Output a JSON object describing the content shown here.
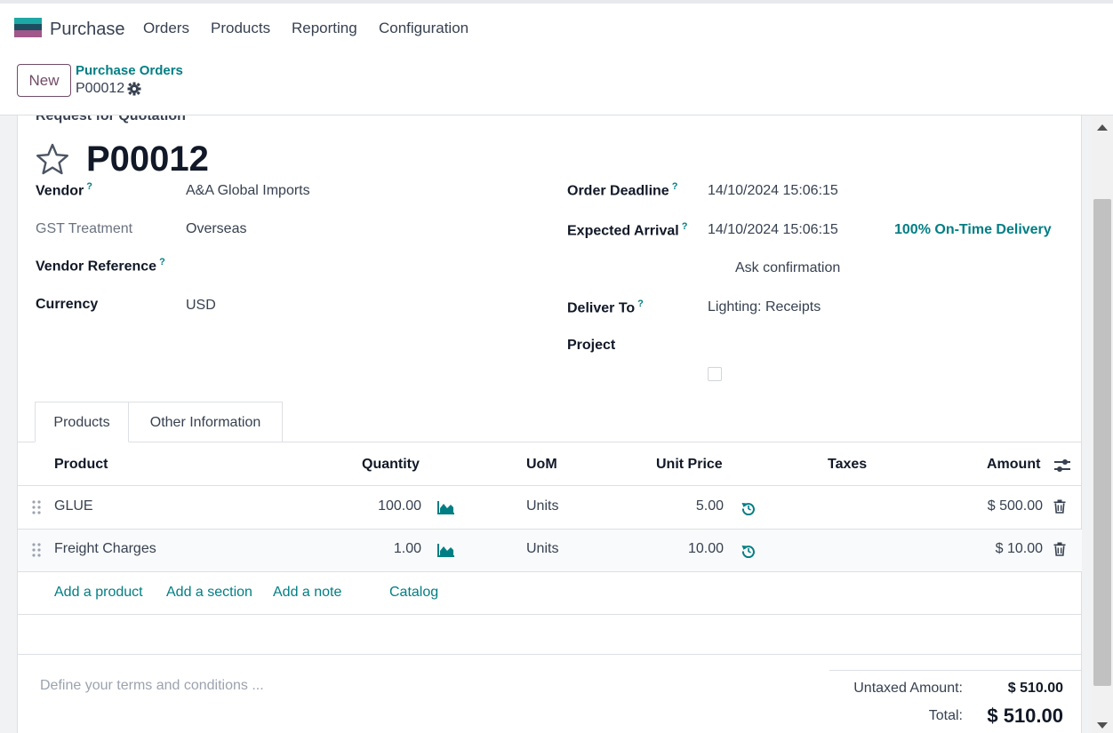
{
  "app": {
    "name": "Purchase",
    "menu": [
      "Orders",
      "Products",
      "Reporting",
      "Configuration"
    ]
  },
  "control_panel": {
    "new_label": "New",
    "breadcrumb": "Purchase Orders",
    "record": "P00012"
  },
  "form": {
    "status_title": "Request for Quotation",
    "order_ref": "P00012",
    "left_fields": {
      "vendor": {
        "label": "Vendor",
        "help": "?",
        "value": "A&A Global Imports"
      },
      "gst": {
        "label": "GST Treatment",
        "value": "Overseas"
      },
      "vendor_ref": {
        "label": "Vendor Reference",
        "help": "?",
        "value": ""
      },
      "currency": {
        "label": "Currency",
        "value": "USD"
      }
    },
    "right_fields": {
      "order_deadline": {
        "label": "Order Deadline",
        "help": "?",
        "value": "14/10/2024 15:06:15"
      },
      "expected_arrival": {
        "label": "Expected Arrival",
        "help": "?",
        "value": "14/10/2024 15:06:15"
      },
      "on_time": "100% On-Time Delivery",
      "ask_confirmation": "Ask confirmation",
      "deliver_to": {
        "label": "Deliver To",
        "help": "?",
        "value": "Lighting: Receipts"
      },
      "project": {
        "label": "Project",
        "value": ""
      }
    },
    "tabs": [
      "Products",
      "Other Information"
    ]
  },
  "lines": {
    "headers": {
      "product": "Product",
      "quantity": "Quantity",
      "uom": "UoM",
      "unit_price": "Unit Price",
      "taxes": "Taxes",
      "amount": "Amount"
    },
    "rows": [
      {
        "product": "GLUE",
        "quantity": "100.00",
        "uom": "Units",
        "unit_price": "5.00",
        "taxes": "",
        "amount": "$ 500.00"
      },
      {
        "product": "Freight Charges",
        "quantity": "1.00",
        "uom": "Units",
        "unit_price": "10.00",
        "taxes": "",
        "amount": "$ 10.00"
      }
    ],
    "actions": {
      "add_product": "Add a product",
      "add_section": "Add a section",
      "add_note": "Add a note",
      "catalog": "Catalog"
    }
  },
  "footer": {
    "terms_placeholder": "Define your terms and conditions ...",
    "untaxed_label": "Untaxed Amount:",
    "untaxed_value": "$ 510.00",
    "total_label": "Total:",
    "total_value": "$ 510.00"
  },
  "colors": {
    "brand": "#714b67",
    "accent": "#017e84"
  }
}
